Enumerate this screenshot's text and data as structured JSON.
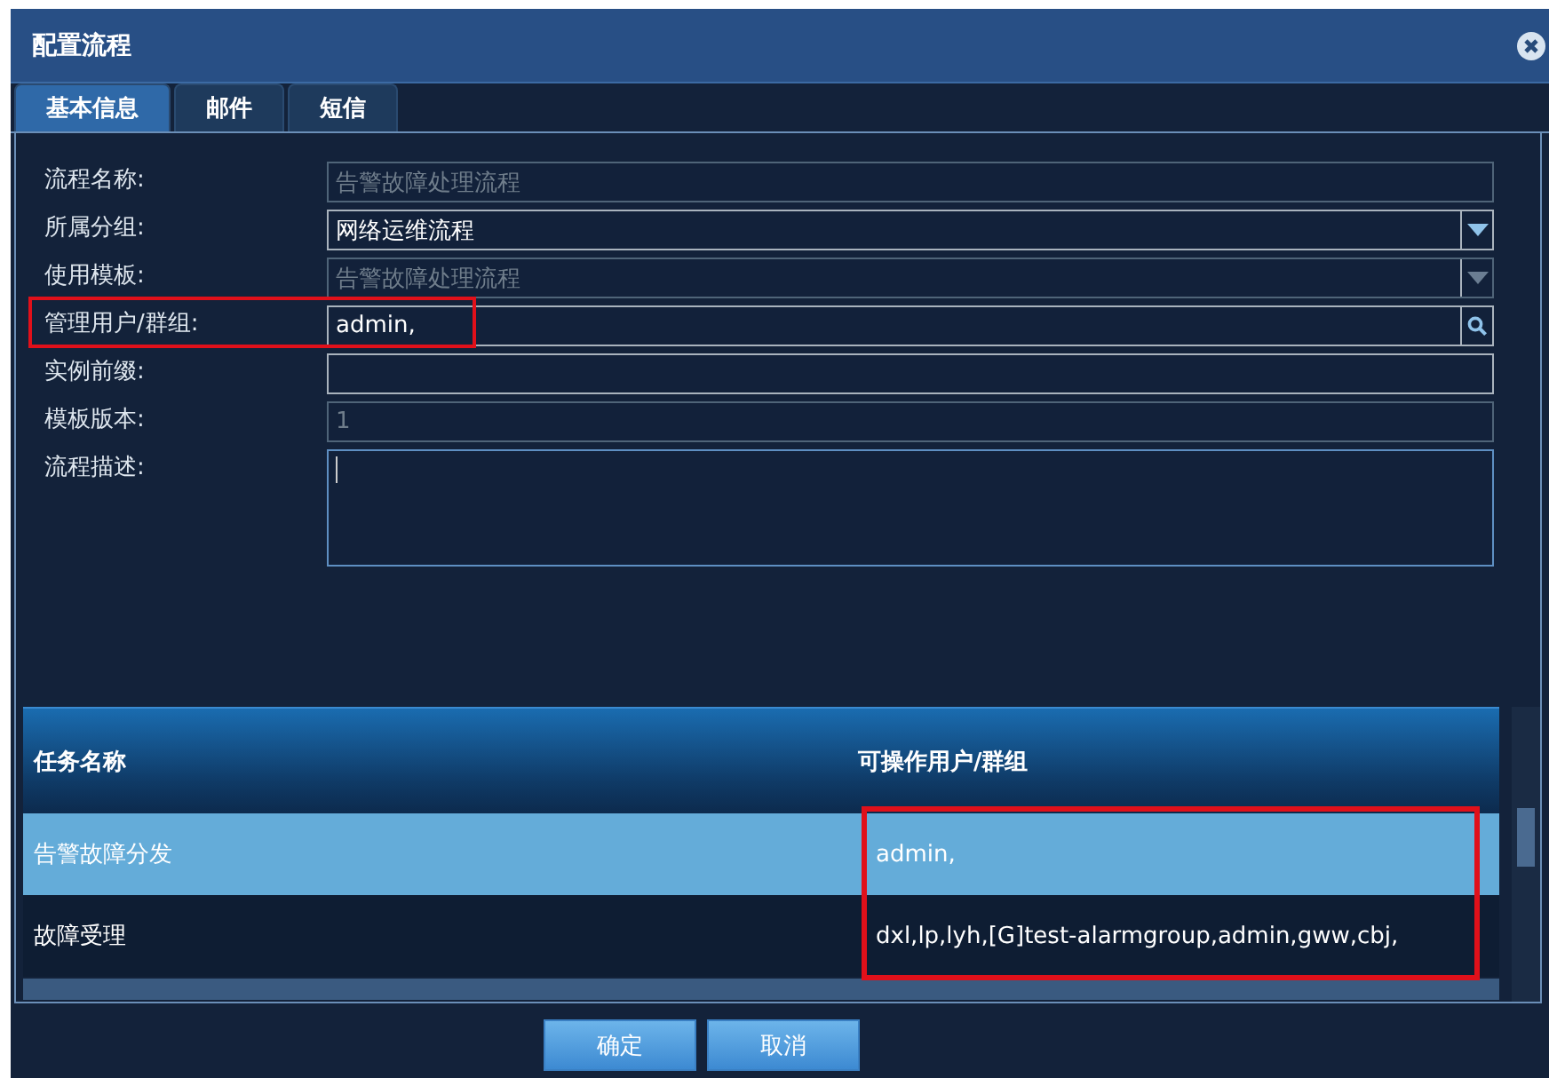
{
  "window": {
    "title": "配置流程"
  },
  "tabs": [
    {
      "label": "基本信息",
      "selected": true
    },
    {
      "label": "邮件",
      "selected": false
    },
    {
      "label": "短信",
      "selected": false
    }
  ],
  "form": [
    {
      "label": "流程名称:",
      "kind": "text",
      "value": "告警故障处理流程",
      "disabled": true,
      "highlighted": false
    },
    {
      "label": "所属分组:",
      "kind": "select",
      "value": "网络运维流程",
      "disabled": false,
      "highlighted": false
    },
    {
      "label": "使用模板:",
      "kind": "select",
      "value": "告警故障处理流程",
      "disabled": true,
      "highlighted": false
    },
    {
      "label": "管理用户/群组:",
      "kind": "search",
      "value": "admin,",
      "disabled": false,
      "highlighted": true
    },
    {
      "label": "实例前缀:",
      "kind": "text",
      "disabled": false,
      "highlighted": false
    },
    {
      "label": "模板版本:",
      "kind": "text",
      "value": "1",
      "disabled": true,
      "highlighted": false
    },
    {
      "label": "流程描述:",
      "kind": "textarea",
      "disabled": false,
      "focused": true,
      "highlighted": false
    }
  ],
  "table": {
    "columns": [
      {
        "label": "任务名称",
        "highlighted": false
      },
      {
        "label": "可操作用户/群组",
        "highlighted": true
      }
    ],
    "rows": [
      {
        "selected": true,
        "cells": [
          "告警故障分发",
          "admin,"
        ]
      },
      {
        "selected": false,
        "cells": [
          "故障受理",
          "dxl,lp,lyh,[G]test-alarmgroup,admin,gww,cbj,"
        ]
      }
    ]
  },
  "buttons": [
    {
      "label": "确定"
    },
    {
      "label": "取消"
    }
  ]
}
